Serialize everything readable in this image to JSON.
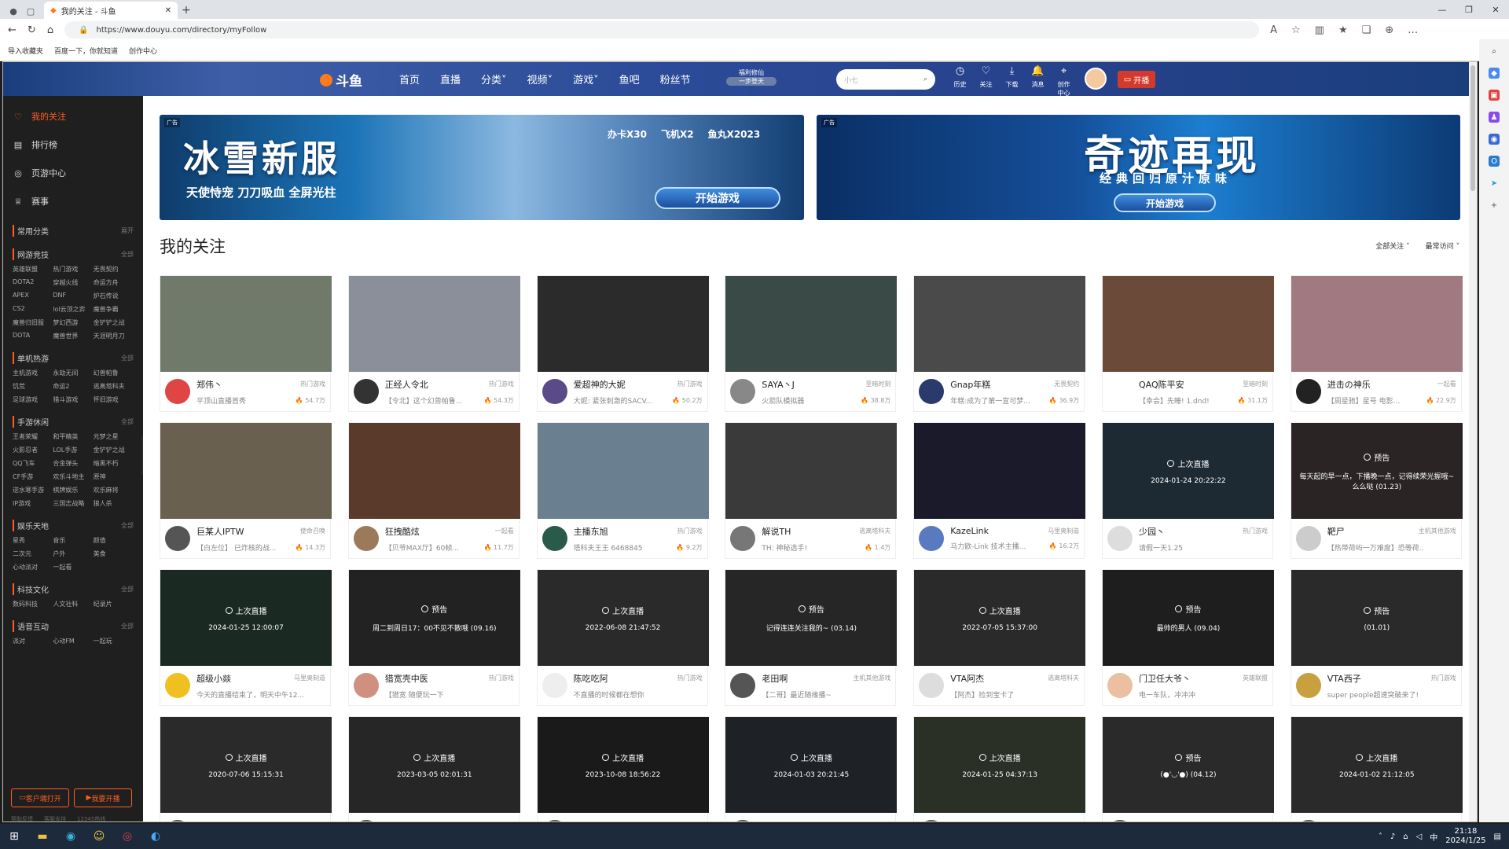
{
  "browser": {
    "tab_title": "我的关注 - 斗鱼",
    "url": "https://www.douyu.com/directory/myFollow",
    "bookmarks": [
      "导入收藏夹",
      "百度一下，你就知道",
      "创作中心"
    ]
  },
  "header": {
    "logo": "斗鱼",
    "nav": [
      "首页",
      "直播",
      "分类",
      "视频",
      "游戏",
      "鱼吧",
      "粉丝节"
    ],
    "promo_top": "福利修仙",
    "promo_bottom": "一步登天",
    "search_placeholder": "小七",
    "icons": [
      {
        "name": "history-icon",
        "label": "历史",
        "glyph": "◷"
      },
      {
        "name": "follow-icon",
        "label": "关注",
        "glyph": "♡"
      },
      {
        "name": "download-icon",
        "label": "下载",
        "glyph": "⤓"
      },
      {
        "name": "message-icon",
        "label": "消息",
        "glyph": "🔔"
      },
      {
        "name": "creator-icon",
        "label": "创作中心",
        "glyph": "⌖"
      }
    ],
    "start_live": "开播"
  },
  "sidebar": {
    "top": [
      {
        "label": "我的关注",
        "icon": "heart-icon",
        "glyph": "♡"
      },
      {
        "label": "排行榜",
        "icon": "rank-icon",
        "glyph": "▤"
      },
      {
        "label": "页游中心",
        "icon": "webgame-icon",
        "glyph": "◎"
      },
      {
        "label": "赛事",
        "icon": "trophy-icon",
        "glyph": "♕"
      }
    ],
    "sections": [
      {
        "title": "常用分类",
        "more": "展开",
        "items": []
      },
      {
        "title": "网游竞技",
        "more": "全部",
        "items": [
          "英雄联盟",
          "热门游戏",
          "无畏契约",
          "DOTA2",
          "穿越火线",
          "命运方舟",
          "APEX",
          "DNF",
          "炉石传说",
          "CS2",
          "lol云顶之弈",
          "魔兽争霸",
          "魔兽归旧服",
          "梦幻西游",
          "金铲铲之战",
          "DOTA",
          "魔兽世界",
          "天涯明月刀"
        ]
      },
      {
        "title": "单机热游",
        "more": "全部",
        "items": [
          "主机游戏",
          "永劫无间",
          "幻兽帕鲁",
          "饥荒",
          "命运2",
          "逃离塔科夫",
          "足球游戏",
          "猎斗游戏",
          "怀旧游戏"
        ]
      },
      {
        "title": "手游休闲",
        "more": "全部",
        "items": [
          "王者荣耀",
          "和平精英",
          "元梦之星",
          "火影忍者",
          "LOL手游",
          "金铲铲之战",
          "QQ飞车",
          "合金弹头",
          "暗黑不朽",
          "CF手游",
          "欢乐斗地主",
          "原神",
          "逆水寒手游",
          "棋牌娱乐",
          "欢乐麻将",
          "IP游戏",
          "三国志战略",
          "狼人杀"
        ]
      },
      {
        "title": "娱乐天地",
        "more": "全部",
        "items": [
          "星秀",
          "音乐",
          "颜值",
          "二次元",
          "户外",
          "美食",
          "心动派对",
          "一起看"
        ]
      },
      {
        "title": "科技文化",
        "more": "全部",
        "items": [
          "数码科技",
          "人文社科",
          "纪录片"
        ]
      },
      {
        "title": "语音互动",
        "more": "全部",
        "items": [
          "派对",
          "心动FM",
          "一起玩"
        ]
      }
    ],
    "client_btn": "客户端打开",
    "live_btn": "我要开播",
    "footer": [
      "帮助反馈",
      "客服支持",
      "12345热线"
    ]
  },
  "banners": [
    {
      "ad": "广告",
      "title": "冰雪新服",
      "sub": "天使恃宠 刀刀吸血 全屏光柱",
      "btn": "开始游戏",
      "badges": [
        "办卡X30",
        "飞机X2",
        "鱼丸X2023"
      ]
    },
    {
      "ad": "广告",
      "title": "奇迹再现",
      "sub": "经典回归原汁原味",
      "btn": "开始游戏"
    }
  ],
  "main": {
    "title": "我的关注",
    "filter1": "全部关注",
    "filter2": "最常访问"
  },
  "cards": [
    {
      "name": "郑伟丶",
      "cat": "热门游戏",
      "desc": "平顶山直播首秀",
      "heat": "54.7万",
      "bg": "#6f7a6a",
      "av": "#e04545"
    },
    {
      "name": "正经人令北",
      "cat": "热门游戏",
      "desc": "【令北】这个幻兽帕鲁...",
      "heat": "54.3万",
      "bg": "#8a8f99",
      "av": "#333"
    },
    {
      "name": "爱超神的大妮",
      "cat": "热门游戏",
      "desc": "大妮: 紧张刺激的SACV...",
      "heat": "50.2万",
      "bg": "#2b2b2b",
      "av": "#5a4a8a"
    },
    {
      "name": "SAYA丶J",
      "cat": "至暗时刻",
      "desc": "火箭队模拟器",
      "heat": "38.8万",
      "bg": "#3a4a46",
      "av": "#888"
    },
    {
      "name": "Gnap年糕",
      "cat": "无畏契约",
      "desc": "年糕:成为了第一宣可梦...",
      "heat": "36.9万",
      "bg": "#4a4a4a",
      "av": "#2a3a6a"
    },
    {
      "name": "QAQ陈平安",
      "cat": "至暗时刻",
      "desc": "【幸会】先睡! 1.dnd!",
      "heat": "31.1万",
      "bg": "#6b4a3a",
      "av": "#fff"
    },
    {
      "name": "进击の神乐",
      "cat": "一起看",
      "desc": "【周星驰】星号 电影...",
      "heat": "22.9万",
      "bg": "#a07a80",
      "av": "#222"
    },
    {
      "name": "巨某人IPTW",
      "cat": "使命召唤",
      "desc": "【白左位】 已炸核的战...",
      "heat": "14.3万",
      "bg": "#6a6050",
      "av": "#555"
    },
    {
      "name": "狂拽酷炫",
      "cat": "一起看",
      "desc": "【贝爷MAX厅】60帧...",
      "heat": "11.7万",
      "bg": "#5a3a2a",
      "av": "#9a7a5a"
    },
    {
      "name": "主播东旭",
      "cat": "热门游戏",
      "desc": "塔科夫王王 6468845",
      "heat": "9.2万",
      "bg": "#6a8090",
      "av": "#2a5a4a"
    },
    {
      "name": "解说TH",
      "cat": "逃离塔科夫",
      "desc": "TH: 神秘选手!",
      "heat": "1.4万",
      "bg": "#3a3a3a",
      "av": "#777"
    },
    {
      "name": "KazeLink",
      "cat": "马里奥制造",
      "desc": "马力欧-Link 技术主播...",
      "heat": "16.2万",
      "bg": "#1a1a2a",
      "av": "#5a7ac0"
    },
    {
      "name": "少园丶",
      "cat": "热门游戏",
      "desc": "请假一天1.25",
      "heat": "",
      "bg": "#1d2a33",
      "av": "#ddd",
      "status": "上次直播",
      "time": "2024-01-24 20:22:22"
    },
    {
      "name": "靶尸",
      "cat": "主机其他游戏",
      "desc": "【热带荷屿一万难度】恐等荷..",
      "heat": "",
      "bg": "#2a2424",
      "av": "#ccc",
      "status": "预告",
      "time": "每天起的早一点，下播晚一点，记得续荣光握哦~么么哒 (01.23)"
    },
    {
      "name": "超级小燚",
      "cat": "马里奥制造",
      "desc": "今天的直播结束了，明天中午12...",
      "heat": "",
      "bg": "#1a2a22",
      "av": "#f0c020",
      "status": "上次直播",
      "time": "2024-01-25 12:00:07"
    },
    {
      "name": "猎宽壳中医",
      "cat": "热门游戏",
      "desc": "【猎宽 随便玩一下",
      "heat": "",
      "bg": "#222",
      "av": "#d09080",
      "status": "预告",
      "time": "周二到周日17：00不见不散哦 (09.16)"
    },
    {
      "name": "陈吃吃阿",
      "cat": "热门游戏",
      "desc": "不直播的时候都在想你",
      "heat": "",
      "bg": "#2a2a2a",
      "av": "#eee",
      "status": "上次直播",
      "time": "2022-06-08 21:47:52"
    },
    {
      "name": "老田啊",
      "cat": "主机其他游戏",
      "desc": "【二哥】最近随缘播~",
      "heat": "",
      "bg": "#262626",
      "av": "#555",
      "status": "预告",
      "time": "记得连连关注我的~ (03.14)"
    },
    {
      "name": "VTA阿杰",
      "cat": "逃离塔科夫",
      "desc": "【阿杰】捡到宝卡了",
      "heat": "",
      "bg": "#2a2a2a",
      "av": "#ddd",
      "status": "上次直播",
      "time": "2022-07-05 15:37:00"
    },
    {
      "name": "门卫任大爷丶",
      "cat": "英雄联盟",
      "desc": "电一车队，冲冲冲",
      "heat": "",
      "bg": "#1e1e1e",
      "av": "#eac0a0",
      "status": "预告",
      "time": "最帅的男人 (09.04)"
    },
    {
      "name": "VTA西子",
      "cat": "热门游戏",
      "desc": "super people超速突破来了!",
      "heat": "",
      "bg": "#2a2a2a",
      "av": "#c9a040",
      "status": "预告",
      "time": "(01.01)"
    },
    {
      "name": "",
      "cat": "",
      "desc": "",
      "heat": "",
      "bg": "#2a2a2a",
      "av": "#555",
      "status": "上次直播",
      "time": "2020-07-06 15:15:31"
    },
    {
      "name": "",
      "cat": "",
      "desc": "",
      "heat": "",
      "bg": "#262626",
      "av": "#555",
      "status": "上次直播",
      "time": "2023-03-05 02:01:31"
    },
    {
      "name": "",
      "cat": "",
      "desc": "",
      "heat": "",
      "bg": "#1a1a1a",
      "av": "#555",
      "status": "上次直播",
      "time": "2023-10-08 18:56:22"
    },
    {
      "name": "",
      "cat": "",
      "desc": "",
      "heat": "",
      "bg": "#1e2226",
      "av": "#555",
      "status": "上次直播",
      "time": "2024-01-03 20:21:45"
    },
    {
      "name": "",
      "cat": "",
      "desc": "",
      "heat": "",
      "bg": "#2a3026",
      "av": "#555",
      "status": "上次直播",
      "time": "2024-01-25 04:37:13"
    },
    {
      "name": "",
      "cat": "",
      "desc": "",
      "heat": "",
      "bg": "#2a2a2a",
      "av": "#555",
      "status": "预告",
      "time": "(●'◡'●) (04.12)"
    },
    {
      "name": "",
      "cat": "",
      "desc": "",
      "heat": "",
      "bg": "#2a2a2a",
      "av": "#555",
      "status": "上次直播",
      "time": "2024-01-02 21:12:05"
    }
  ],
  "taskbar": {
    "time": "21:18",
    "date": "2024/1/25",
    "lang": "中"
  }
}
